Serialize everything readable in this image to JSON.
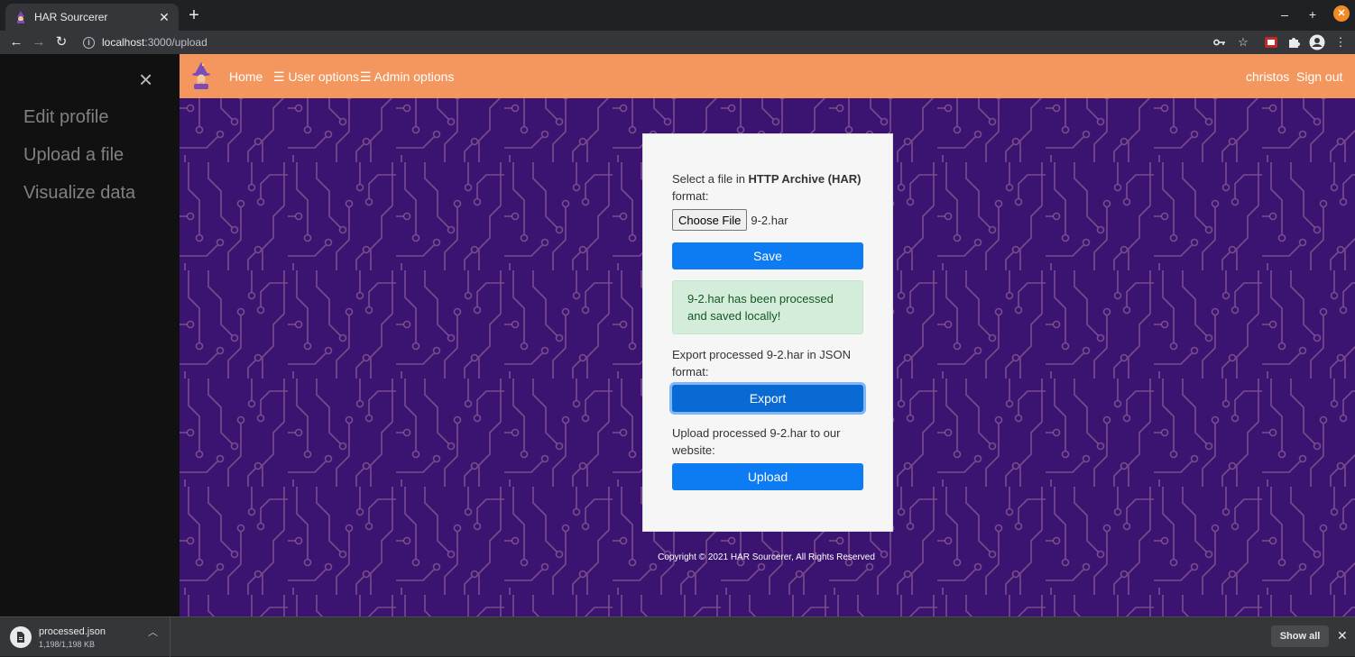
{
  "browser": {
    "tab_title": "HAR Sourcerer",
    "url_host": "localhost",
    "url_path": ":3000/upload",
    "icons": [
      "key-icon",
      "star-icon",
      "extension-red-icon",
      "puzzle-icon",
      "profile-icon",
      "menu-icon"
    ]
  },
  "sidebar": {
    "close": "×",
    "items": [
      {
        "label": "Edit profile"
      },
      {
        "label": "Upload a file"
      },
      {
        "label": "Visualize data"
      }
    ]
  },
  "navbar": {
    "home": "Home",
    "user_options": "☰ User options",
    "admin_options": "☰ Admin options",
    "username": "christos",
    "sign_out": "Sign out"
  },
  "upload": {
    "select_prefix": "Select a file in ",
    "select_bold": "HTTP Archive (HAR)",
    "select_suffix": "format:",
    "choose_file": "Choose File",
    "file_name": "9-2.har",
    "save": "Save",
    "alert": "9-2.har has been processed and saved locally!",
    "export_text": "Export processed 9-2.har in JSON format:",
    "export": "Export",
    "upload_text": "Upload processed 9-2.har to our website:",
    "upload": "Upload"
  },
  "footer": "Copyright © 2021 HAR Sourcerer, All Rights Reserved",
  "downloads": {
    "file_name": "processed.json",
    "size": "1,198/1,198 KB",
    "show_all": "Show all"
  },
  "colors": {
    "navbar": "#f4975e",
    "background": "#3a1470",
    "circuit": "#7a4a8e",
    "button": "#0d7bf2",
    "alert_bg": "#d4edda"
  }
}
